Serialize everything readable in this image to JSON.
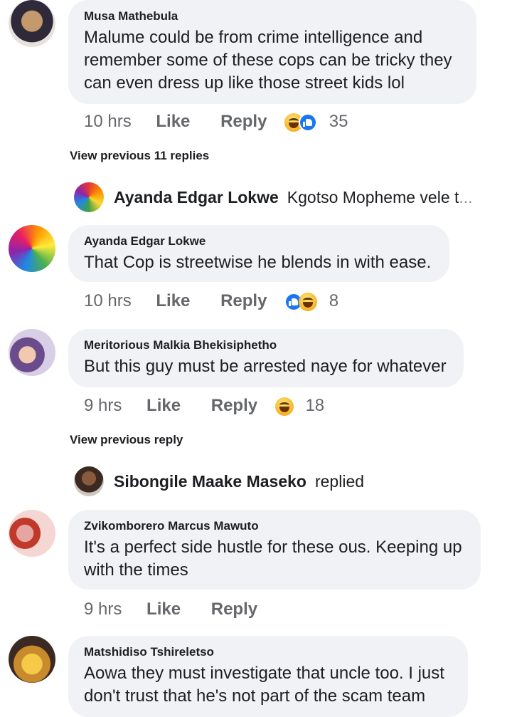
{
  "comments": [
    {
      "author": "Musa Mathebula",
      "lines": [
        "Malume could be from crime intelligence and",
        "remember  some of these cops can be tricky they",
        "can even dress up like those street kids lol"
      ],
      "time": "10 hrs",
      "like_label": "Like",
      "reply_label": "Reply",
      "reactions": [
        "haha-icon",
        "like-icon"
      ],
      "reaction_count": "35"
    },
    {
      "author": "Ayanda Edgar Lokwe",
      "lines": [
        "That Cop is streetwise he blends in with ease."
      ],
      "time": "10 hrs",
      "like_label": "Like",
      "reply_label": "Reply",
      "reactions": [
        "like-icon",
        "haha-icon"
      ],
      "reaction_count": "8"
    },
    {
      "author": "Meritorious Malkia Bhekisiphetho",
      "lines": [
        "But this guy must be arrested naye for whatever"
      ],
      "time": "9 hrs",
      "like_label": "Like",
      "reply_label": "Reply",
      "reactions": [
        "haha-icon"
      ],
      "reaction_count": "18"
    },
    {
      "author": "Zvikomborero Marcus Mawuto",
      "lines": [
        "It's a perfect side hustle for these ous. Keeping up",
        "with the times"
      ],
      "time": "9 hrs",
      "like_label": "Like",
      "reply_label": "Reply"
    },
    {
      "author": "Matshidiso Tshireletso",
      "lines": [
        "Aowa they must investigate that uncle too. I just",
        "don't trust that he's not part of the scam team"
      ]
    }
  ],
  "view_replies": [
    {
      "label": "View previous 11 replies"
    },
    {
      "label": "View previous reply"
    }
  ],
  "reply_previews": [
    {
      "name": "Ayanda Edgar Lokwe",
      "snippet": "Kgotso Mopheme vele t",
      "ellipsis": "..."
    },
    {
      "name": "Sibongile Maake Maseko",
      "snippet": "replied",
      "ellipsis": ""
    }
  ],
  "colors": {
    "bubble": "#f0f2f5",
    "meta_text": "#65676b",
    "like_blue": "#1877f2",
    "haha_yellow": "#f7b125"
  }
}
